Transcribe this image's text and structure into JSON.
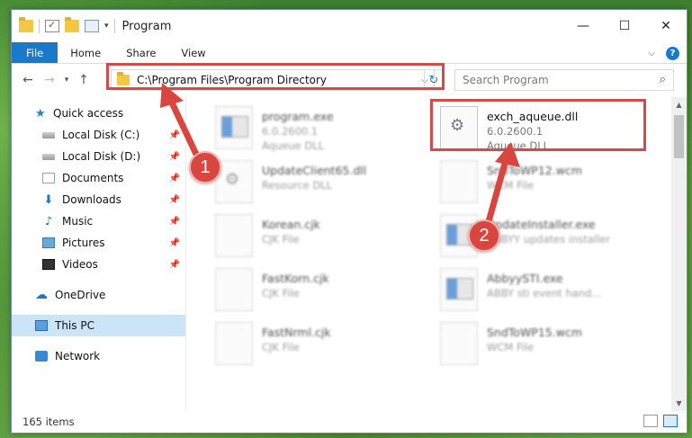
{
  "window": {
    "title": "Program",
    "controls": {
      "minimize": "—",
      "maximize": "☐",
      "close": "✕"
    }
  },
  "ribbon": {
    "tabs": [
      "File",
      "Home",
      "Share",
      "View"
    ],
    "help": "?"
  },
  "address": {
    "path": "C:\\Program Files\\Program Directory",
    "search_placeholder": "Search Program"
  },
  "sidebar": {
    "quick_access": "Quick access",
    "items": [
      {
        "label": "Local Disk (C:)",
        "icon": "drive-icon"
      },
      {
        "label": "Local Disk (D:)",
        "icon": "drive-icon"
      },
      {
        "label": "Documents",
        "icon": "documents-icon"
      },
      {
        "label": "Downloads",
        "icon": "downloads-icon"
      },
      {
        "label": "Music",
        "icon": "music-icon"
      },
      {
        "label": "Pictures",
        "icon": "pictures-icon"
      },
      {
        "label": "Videos",
        "icon": "videos-icon"
      }
    ],
    "onedrive": "OneDrive",
    "this_pc": "This PC",
    "network": "Network"
  },
  "files": [
    {
      "name": "program.exe",
      "line2": "6.0.2600.1",
      "line3": "Aqueue DLL",
      "icon": "exe-icon",
      "blurred": true
    },
    {
      "name": "exch_aqueue.dll",
      "line2": "6.0.2600.1",
      "line3": "Aqueue DLL",
      "icon": "dll-gear-icon",
      "blurred": false,
      "highlighted": true
    },
    {
      "name": "UpdateClient65.dll",
      "line2": "Resource DLL",
      "icon": "dll-gear-icon",
      "blurred": true
    },
    {
      "name": "SndToWP12.wcm",
      "line2": "WCM File",
      "icon": "file-icon",
      "blurred": true
    },
    {
      "name": "Korean.cjk",
      "line2": "CJK File",
      "icon": "file-icon",
      "blurred": true
    },
    {
      "name": "UpdateInstaller.exe",
      "line2": "ABBYY updates installer",
      "icon": "exe-icon",
      "blurred": true
    },
    {
      "name": "FastKorn.cjk",
      "line2": "CJK File",
      "icon": "file-icon",
      "blurred": true
    },
    {
      "name": "AbbyySTI.exe",
      "line2": "ABBY sti event hand...",
      "icon": "exe-icon",
      "blurred": true
    },
    {
      "name": "FastNrml.cjk",
      "line2": "CJK File",
      "icon": "file-icon",
      "blurred": true
    },
    {
      "name": "SndToWP15.wcm",
      "line2": "WCM File",
      "icon": "file-icon",
      "blurred": true
    }
  ],
  "status": {
    "count": "165 items"
  },
  "annotations": {
    "step1": "1",
    "step2": "2",
    "color": "#d9463f"
  }
}
